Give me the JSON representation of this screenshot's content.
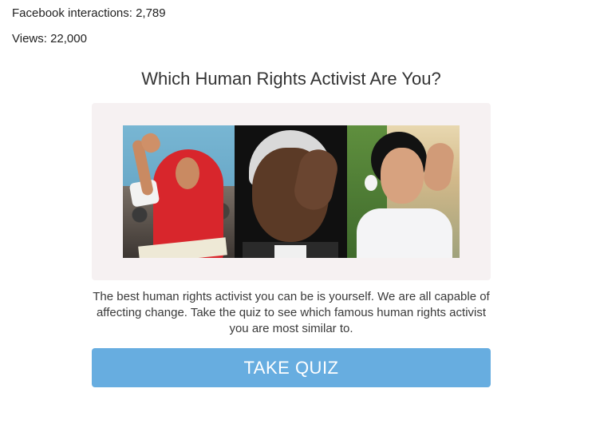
{
  "stats": {
    "facebook_interactions": "Facebook interactions: 2,789",
    "views": "Views: 22,000"
  },
  "quiz": {
    "title": "Which Human Rights Activist Are You?",
    "description": "The best human rights activist you can be is yourself. We are all capable of affecting change. Take the quiz to see which famous human rights activist you are most similar to.",
    "button_label": "TAKE QUIZ"
  },
  "colors": {
    "button_bg": "#67ade0",
    "card_bg": "#f6f1f2"
  }
}
